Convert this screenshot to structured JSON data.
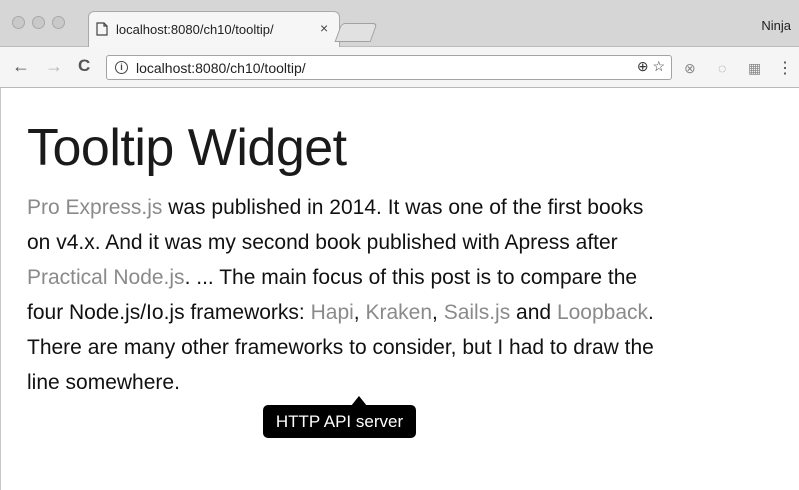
{
  "browser": {
    "tab_title": "localhost:8080/ch10/tooltip/",
    "tab_close": "×",
    "profile_name": "Ninja",
    "url": "localhost:8080/ch10/tooltip/",
    "back_glyph": "←",
    "forward_glyph": "→",
    "reload_glyph": "C",
    "zoom_glyph": "⊕",
    "star_glyph": "☆",
    "menu_glyph": "⋮"
  },
  "page": {
    "heading": "Tooltip Widget",
    "paragraph": {
      "link1": "Pro Express.js",
      "text1": " was published in 2014. It was one of the first books on v4.x. And it was my second book published with Apress after ",
      "link2": "Practical Node.js",
      "text2": ". ... The main focus of this post is to compare the four Node.js/Io.js frameworks: ",
      "link3": "Hapi",
      "text3": ", ",
      "link4": "Kraken",
      "text4": ", ",
      "link5": "Sails.js",
      "text5": " and ",
      "link6": "Loopback",
      "text6": ". There are many other frameworks to consider, but I had to draw the line somewhere."
    },
    "tooltip": "HTTP API server"
  },
  "colors": {
    "link": "#8a8a8a",
    "tooltip_bg": "#000000",
    "heading": "#1a1a1a"
  }
}
